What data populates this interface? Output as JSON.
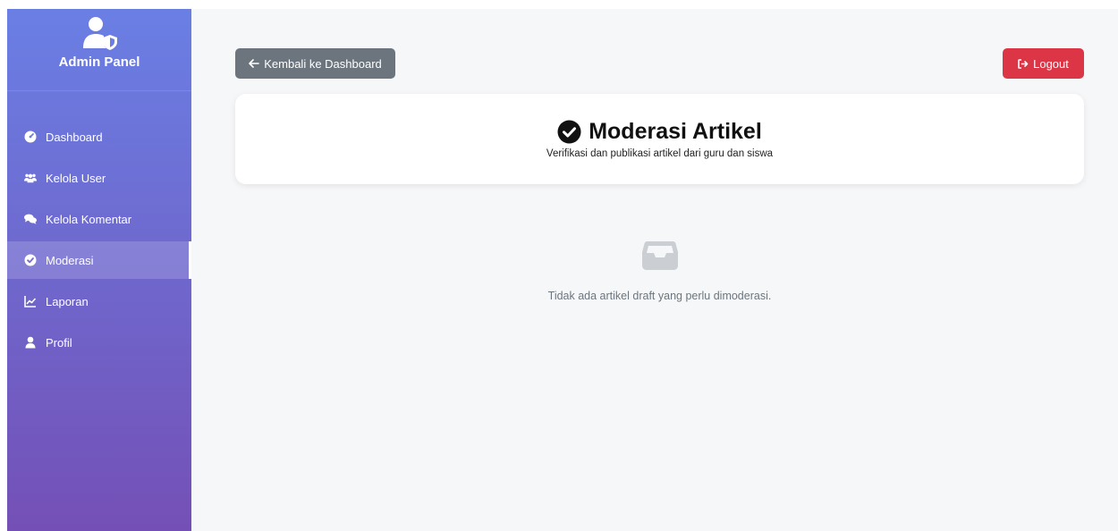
{
  "sidebar": {
    "brand_title": "Admin Panel",
    "brand_icon": "user-shield-icon",
    "items": [
      {
        "label": "Dashboard",
        "icon": "gauge-icon",
        "active": false
      },
      {
        "label": "Kelola User",
        "icon": "users-icon",
        "active": false
      },
      {
        "label": "Kelola Komentar",
        "icon": "comments-icon",
        "active": false
      },
      {
        "label": "Moderasi",
        "icon": "check-circle-icon",
        "active": true
      },
      {
        "label": "Laporan",
        "icon": "chart-line-icon",
        "active": false
      },
      {
        "label": "Profil",
        "icon": "user-icon",
        "active": false
      }
    ]
  },
  "toolbar": {
    "back_label": "Kembali ke Dashboard",
    "logout_label": "Logout"
  },
  "header": {
    "title": "Moderasi Artikel",
    "subtitle": "Verifikasi dan publikasi artikel dari guru dan siswa"
  },
  "empty_state": {
    "icon": "inbox-icon",
    "message": "Tidak ada artikel draft yang perlu dimoderasi."
  },
  "colors": {
    "sidebar_top": "#6a7fe4",
    "sidebar_bottom": "#7450b6",
    "back_button": "#6c757d",
    "logout_button": "#dc3545",
    "background": "#f6f7f9"
  }
}
